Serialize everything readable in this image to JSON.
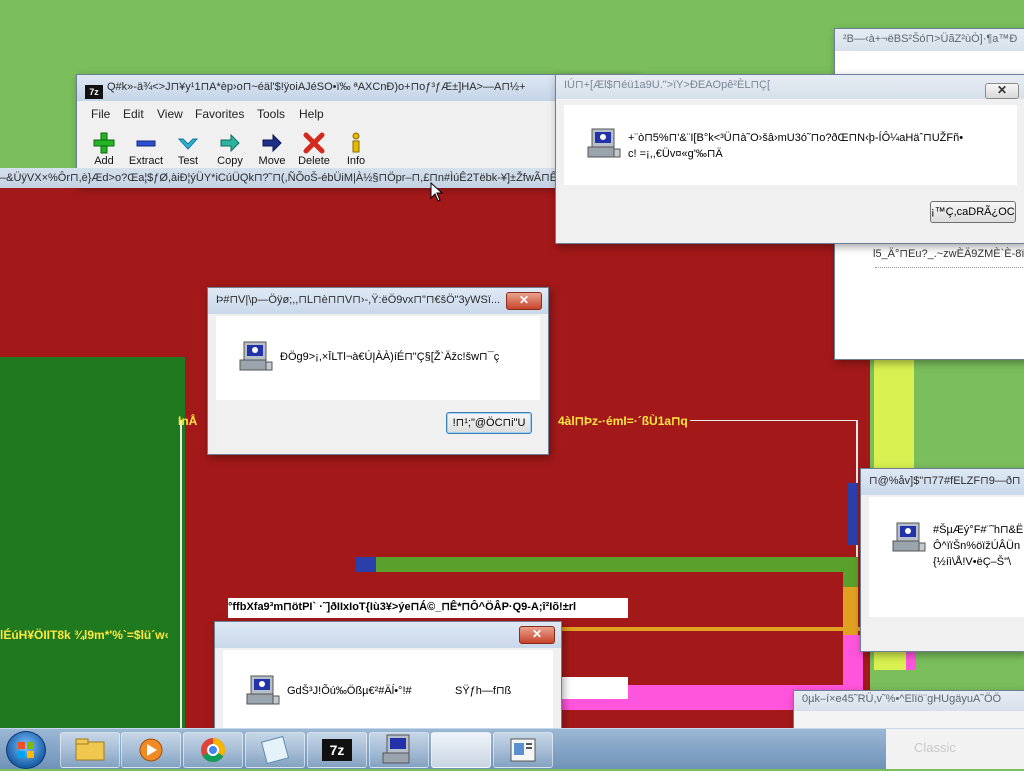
{
  "desktop": {
    "background": "#7bbf5c"
  },
  "main_window": {
    "title": "Q#k»-ä¾<>J⊓¥y¹1⊓A*èp›o⊓~éäl'$!ÿoiAJéSO•ï‰ ªAXCnÐ)o+⊓oƒ³ƒÆ±]HA>—A⊓½+",
    "menu": [
      "File",
      "Edit",
      "View",
      "Favorites",
      "Tools",
      "Help"
    ],
    "tools": [
      {
        "label": "Add",
        "icon": "plus-icon"
      },
      {
        "label": "Extract",
        "icon": "minus-icon"
      },
      {
        "label": "Test",
        "icon": "check-icon"
      },
      {
        "label": "Copy",
        "icon": "copy-arrow-icon"
      },
      {
        "label": "Move",
        "icon": "move-arrow-icon"
      },
      {
        "label": "Delete",
        "icon": "delete-x-icon"
      },
      {
        "label": "Info",
        "icon": "info-icon"
      }
    ]
  },
  "garbled_bar": {
    "text": "–&ÜÿVX×%Ôr⊓,è}Æd>o?Œa¦$ƒØ,àiÐ¦ýÜY*iCúÜQk⊓?˜⊓(,ÑÕoŠ-ébÜiM|À½§⊓Öpr–⊓,£⊓n#ÌúÊ2Tëbk-¥]±ŽfwÃ⊓ÊÐ"
  },
  "dialog_top": {
    "title": "IÚ⊓+[Æl$⊓éü1a9U.\">ïY>ÐEAOpê²ÈL⊓Ç[",
    "message_line1": "+¨ò⊓5%⊓'&¨I[B°k<³Ü⊓à˜O›šâ›mU3ó˜⊓o?ðŒ⊓N‹þ-ÍÔ¼aHäˆ⊓UŽFñ•",
    "message_line2": "c! =¡,,€Üv¤«g'‰⊓Ä",
    "button": "¡™Ç,caDRÃ¿OC⊓"
  },
  "dialog_center": {
    "title": "Þ#⊓V|\\p—Öÿø;,,⊓L⊓è⊓⊓V⊓›-,Ÿ:ëÖ9vx⊓\"⊓€šÖ\"3yWSï...",
    "message": "ÐÖg9>¡,×ĪLTl¬à€ÚĮÀÀ)íÉ⊓\"Ç§[Ž`Äžc!šw⊓¯ç",
    "button": "!⊓¹;\"@ÖC⊓i\"U"
  },
  "dialog_bottom": {
    "message_left": "GdŠ³J!Õú‰Ößµ€²#Äĺ•°!#",
    "message_right": "SŸƒh—f⊓ß"
  },
  "dialog_right": {
    "title": "⊓@%åv]$\"⊓77#fELZF⊓9—ð⊓",
    "lines": [
      "#ŠµÆý°F#¨˜h⊓&Ë",
      "Ô^ïïŠn%öïžÚÂÜn",
      "{½íì\\Å!V•ëÇ–Š\"\\"
    ]
  },
  "top_right_window": {
    "title": "²B—‹à+¬ëBS²Šó⊓>ÜãZ²ùÒ]·¶a™Ð"
  },
  "mid_right_window": {
    "text": "l5_Ä°⊓Eu?_.~zwÈÄ9ZMÈ`È-8ï"
  },
  "bottom_right_window": {
    "title": "0µk–í×e45˜RÜ,v˜%•^Elïö¨gHUgäyuA˜ÖÖ"
  },
  "overlays": {
    "yellow_left": "InÅ",
    "yellow_right": "4àl⊓Þz-·émI=·´ßÙ1a⊓q",
    "yellow_bottom_left": "lÉúH¥ÖIIT8k ¾l9m*'%`=$lü´w‹",
    "white_banner": "°ffbXfa9³m⊓ötPI`  ·˜]ðIIxIoT{Iù3¥>ýe⊓Á©_⊓Ê*⊓Ô^ÖÂP·Q9-A;î²Iõ!±rl"
  },
  "taskbar_right_text": "Classic",
  "colors": {
    "red": "#a31919",
    "dark_green": "#1f7a1f",
    "yellow_text": "#ffe640",
    "light_yellow": "#d8f050",
    "navy": "#2a3faa",
    "bar_green": "#5aa02c",
    "orange": "#e0a020",
    "magenta": "#ff55dd"
  }
}
